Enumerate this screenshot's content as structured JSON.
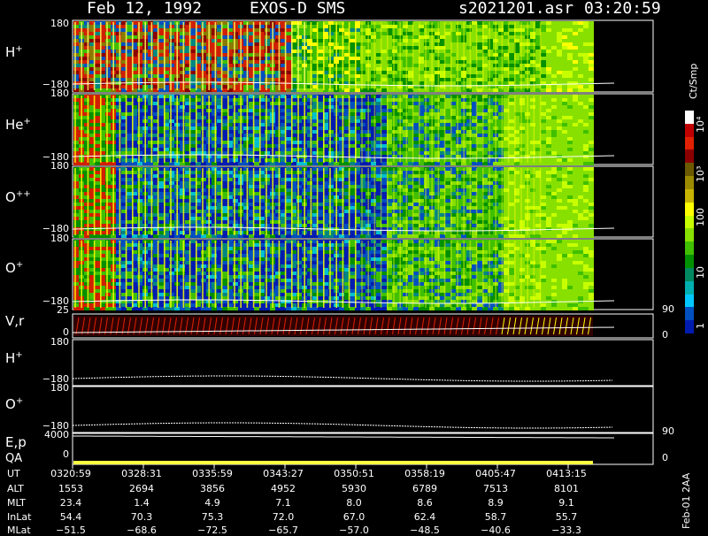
{
  "header": {
    "date": "Feb 12, 1992",
    "instrument": "EXOS-D SMS",
    "file": "s2021201.asr",
    "time": "03:20:59"
  },
  "panels": [
    {
      "label": "H",
      "charge": "+",
      "ymax": "180",
      "ymin": "−180"
    },
    {
      "label": "He",
      "charge": "+",
      "ymax": "180",
      "ymin": "−180"
    },
    {
      "label": "O",
      "charge": "++",
      "ymax": "180",
      "ymin": "−180"
    },
    {
      "label": "O",
      "charge": "+",
      "ymax": "180",
      "ymin": "−180"
    },
    {
      "label": "V,r",
      "charge": "",
      "ymax": "25",
      "ymin": "0",
      "right_top": "90",
      "right_bottom": "0"
    },
    {
      "label": "H",
      "charge": "+",
      "ymax": "180",
      "ymin": "−180"
    },
    {
      "label": "O",
      "charge": "+",
      "ymax": "180",
      "ymin": "−180"
    },
    {
      "label": "E,p",
      "label2": "QA",
      "ymax": "4000",
      "ymin": "0",
      "right_top": "90",
      "right_bottom": "0"
    }
  ],
  "colorbar": {
    "title": "Ct/Smp",
    "labels": [
      "10⁴",
      "10³",
      "100",
      "10",
      "1"
    ],
    "colors": [
      "#ffffff",
      "#c00000",
      "#e02000",
      "#8b0000",
      "#6b5a00",
      "#9a8a00",
      "#c8b400",
      "#ffff00",
      "#c8ff00",
      "#88e000",
      "#40c000",
      "#009000",
      "#008860",
      "#00b0b0",
      "#00c8ff",
      "#0050c0",
      "#001cb0"
    ]
  },
  "footer_label": "Feb-01 2AA",
  "orbit_table": {
    "row_labels": [
      "UT",
      "ALT",
      "MLT",
      "InLat",
      "MLat"
    ],
    "columns": [
      [
        "0320:59",
        "1553",
        "23.4",
        "54.4",
        "−51.5"
      ],
      [
        "0328:31",
        "2694",
        "1.4",
        "70.3",
        "−68.6"
      ],
      [
        "0335:59",
        "3856",
        "4.9",
        "75.3",
        "−72.5"
      ],
      [
        "0343:27",
        "4952",
        "7.1",
        "72.0",
        "−65.7"
      ],
      [
        "0350:51",
        "5930",
        "8.0",
        "67.0",
        "−57.0"
      ],
      [
        "0358:19",
        "6789",
        "8.6",
        "62.4",
        "−48.5"
      ],
      [
        "0405:47",
        "7513",
        "8.9",
        "58.7",
        "−40.6"
      ],
      [
        "0413:15",
        "8101",
        "9.1",
        "55.7",
        "−33.3"
      ]
    ]
  },
  "chart_data": {
    "type": "heatmap",
    "title": "Feb 12, 1992   EXOS-D SMS",
    "x_ticks_ut": [
      "0320:59",
      "0328:31",
      "0335:59",
      "0343:27",
      "0350:51",
      "0358:19",
      "0405:47",
      "0413:15"
    ],
    "colorbar_unit": "Ct/Smp",
    "colorbar_scale": "log",
    "colorbar_range": [
      1,
      10000
    ],
    "pitch_angle_range": [
      -180,
      180
    ],
    "series": [
      {
        "name": "H+",
        "dominant_counts": "10-1000"
      },
      {
        "name": "He+",
        "dominant_counts": "1-100"
      },
      {
        "name": "O++",
        "dominant_counts": "1-100"
      },
      {
        "name": "O+",
        "dominant_counts": "1-100"
      }
    ],
    "grid": false
  }
}
